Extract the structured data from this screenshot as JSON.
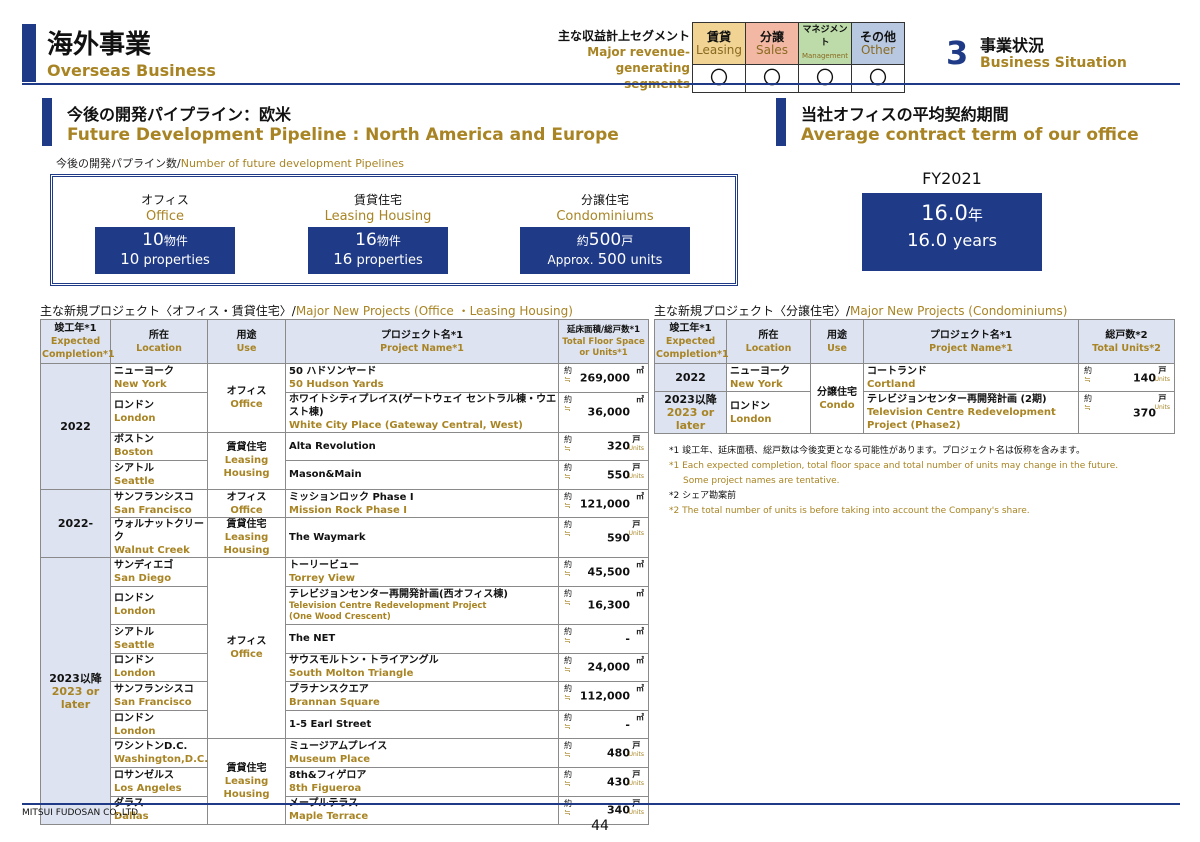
{
  "header": {
    "title": "海外事業",
    "subtitle": "Overseas Business",
    "segment_label_jp": "主な収益計上セグメント",
    "segment_label_en1": "Major revenue-",
    "segment_label_en2": "generating segments",
    "segments": [
      {
        "jp": "賃貸",
        "en": "Leasing",
        "mark": "〇",
        "color": "#f1d493"
      },
      {
        "jp": "分譲",
        "en": "Sales",
        "mark": "〇",
        "color": "#f2b8a3"
      },
      {
        "jp": "マネジメント",
        "en": "Management",
        "mark": "〇",
        "color": "#bcdba8"
      },
      {
        "jp": "その他",
        "en": "Other",
        "mark": "〇",
        "color": "#b8c8e0"
      }
    ],
    "section_number": "3",
    "section_jp": "事業状況",
    "section_en": "Business Situation"
  },
  "pipeline": {
    "heading_jp": "今後の開発パイプライン：欧米",
    "heading_en": "Future Development Pipeline : North America and Europe",
    "caption_jp": "今後の開発パプライン数/",
    "caption_en": "Number of future development Pipelines",
    "items": [
      {
        "jp": "オフィス",
        "en": "Office",
        "value_jp": "10",
        "unit_jp": "物件",
        "value_en": "10",
        "unit_en": "properties",
        "prefix_jp": "",
        "prefix_en": ""
      },
      {
        "jp": "賃貸住宅",
        "en": "Leasing Housing",
        "value_jp": "16",
        "unit_jp": "物件",
        "value_en": "16",
        "unit_en": "properties",
        "prefix_jp": "",
        "prefix_en": ""
      },
      {
        "jp": "分譲住宅",
        "en": "Condominiums",
        "value_jp": "500",
        "unit_jp": "戸",
        "value_en": "500",
        "unit_en": "units",
        "prefix_jp": "約",
        "prefix_en": "Approx."
      }
    ]
  },
  "contract": {
    "heading_jp": "当社オフィスの平均契約期間",
    "heading_en": "Average contract term of our office",
    "fy": "FY2021",
    "value_jp": "16.0",
    "unit_jp": "年",
    "value_en": "16.0",
    "unit_en": "years"
  },
  "office_table": {
    "title_jp": "主な新規プロジェクト〈オフィス・賃貸住宅〉/",
    "title_en": "Major New Projects (Office ・Leasing Housing)",
    "headers": {
      "year_jp": "竣工年*1",
      "year_en": "Expected Completion*1",
      "loc_jp": "所在",
      "loc_en": "Location",
      "use_jp": "用途",
      "use_en": "Use",
      "name_jp": "プロジェクト名*1",
      "name_en": "Project Name*1",
      "area_jp": "延床面積/総戸数*1",
      "area_en": "Total Floor Space or Units*1"
    },
    "approx_jp": "約",
    "approx_eq": "≒",
    "unit_sqm": "㎡",
    "unit_units_jp": "戸",
    "unit_units_en": "Units",
    "groups": [
      {
        "year_jp": "2022",
        "year_en": ""
      },
      {
        "year_jp": "2022-",
        "year_en": ""
      },
      {
        "year_jp": "2023以降",
        "year_en": "2023 or later"
      }
    ],
    "uses": [
      {
        "jp": "オフィス",
        "en": "Office"
      },
      {
        "jp": "賃貸住宅",
        "en": "Leasing Housing"
      },
      {
        "jp": "オフィス",
        "en": "Office"
      },
      {
        "jp": "賃貸住宅",
        "en": "Leasing Housing"
      },
      {
        "jp": "オフィス",
        "en": "Office"
      },
      {
        "jp": "賃貸住宅",
        "en": "Leasing Housing"
      }
    ],
    "rows": [
      {
        "loc_jp": "ニューヨーク",
        "loc_en": "New York",
        "name_jp": "50 ハドソンヤード",
        "name_en": "50 Hudson Yards",
        "value": "269,000",
        "unit": "sqm"
      },
      {
        "loc_jp": "ロンドン",
        "loc_en": "London",
        "name_jp": "ホワイトシティプレイス(ゲートウェイ セントラル棟・ウエスト棟)",
        "name_en": "White City Place (Gateway Central, West)",
        "value": "36,000",
        "unit": "sqm"
      },
      {
        "loc_jp": "ボストン",
        "loc_en": "Boston",
        "name_jp": "Alta Revolution",
        "name_en": "",
        "value": "320",
        "unit": "units"
      },
      {
        "loc_jp": "シアトル",
        "loc_en": "Seattle",
        "name_jp": "Mason&Main",
        "name_en": "",
        "value": "550",
        "unit": "units"
      },
      {
        "loc_jp": "サンフランシスコ",
        "loc_en": "San Francisco",
        "name_jp": "ミッションロック Phase I",
        "name_en": "Mission Rock Phase I",
        "value": "121,000",
        "unit": "sqm"
      },
      {
        "loc_jp": "ウォルナットクリーク",
        "loc_en": "Walnut Creek",
        "name_jp": "The Waymark",
        "name_en": "",
        "value": "590",
        "unit": "units"
      },
      {
        "loc_jp": "サンディエゴ",
        "loc_en": "San Diego",
        "name_jp": "トーリービュー",
        "name_en": "Torrey View",
        "value": "45,500",
        "unit": "sqm"
      },
      {
        "loc_jp": "ロンドン",
        "loc_en": "London",
        "name_jp": "テレビジョンセンター再開発計画(西オフィス棟)",
        "name_en": "Television Centre Redevelopment Project",
        "name_en2": "(One Wood Crescent)",
        "value": "16,300",
        "unit": "sqm"
      },
      {
        "loc_jp": "シアトル",
        "loc_en": "Seattle",
        "name_jp": "The NET",
        "name_en": "",
        "value": "-",
        "unit": "sqm"
      },
      {
        "loc_jp": "ロンドン",
        "loc_en": "London",
        "name_jp": "サウスモルトン・トライアングル",
        "name_en": "South Molton Triangle",
        "value": "24,000",
        "unit": "sqm"
      },
      {
        "loc_jp": "サンフランシスコ",
        "loc_en": "San Francisco",
        "name_jp": "ブラナンスクエア",
        "name_en": "Brannan Square",
        "value": "112,000",
        "unit": "sqm"
      },
      {
        "loc_jp": "ロンドン",
        "loc_en": "London",
        "name_jp": "1-5 Earl Street",
        "name_en": "",
        "value": "-",
        "unit": "sqm"
      },
      {
        "loc_jp": "ワシントンD.C.",
        "loc_en": "Washington,D.C.",
        "name_jp": "ミュージアムプレイス",
        "name_en": "Museum Place",
        "value": "480",
        "unit": "units"
      },
      {
        "loc_jp": "ロサンゼルス",
        "loc_en": "Los Angeles",
        "name_jp": "8th&フィゲロア",
        "name_en": "8th Figueroa",
        "value": "430",
        "unit": "units"
      },
      {
        "loc_jp": "ダラス",
        "loc_en": "Dallas",
        "name_jp": "メープルテラス",
        "name_en": "Maple Terrace",
        "value": "340",
        "unit": "units"
      }
    ]
  },
  "condo_table": {
    "title_jp": "主な新規プロジェクト〈分譲住宅〉/",
    "title_en": "Major New Projects (Condominiums)",
    "headers": {
      "year_jp": "竣工年*1",
      "year_en": "Expected Completion*1",
      "loc_jp": "所在",
      "loc_en": "Location",
      "use_jp": "用途",
      "use_en": "Use",
      "name_jp": "プロジェクト名*1",
      "name_en": "Project Name*1",
      "units_jp": "総戸数*2",
      "units_en": "Total Units*2"
    },
    "use_jp": "分譲住宅",
    "use_en": "Condo",
    "rows": [
      {
        "year_jp": "2022",
        "year_en": "",
        "loc_jp": "ニューヨーク",
        "loc_en": "New York",
        "name_jp": "コートランド",
        "name_en": "Cortland",
        "name_en2": "",
        "value": "140"
      },
      {
        "year_jp": "2023以降",
        "year_en": "2023 or later",
        "loc_jp": "ロンドン",
        "loc_en": "London",
        "name_jp": "テレビジョンセンター再開発計画 (2期)",
        "name_en": "Television Centre Redevelopment",
        "name_en2": "Project (Phase2)",
        "value": "370"
      }
    ]
  },
  "notes": {
    "n1_jp": "*1 竣工年、延床面積、総戸数は今後変更となる可能性があります。プロジェクト名は仮称を含みます。",
    "n1_en": "*1 Each expected completion, total floor space and total number of units may change in the future.",
    "n1_en2": "Some project names are tentative.",
    "n2_jp": "*2 シェア勘案前",
    "n2_en": "*2 The total number of units is before taking into account the Company's share."
  },
  "footer": {
    "company": "MITSUI FUDOSAN CO.,LTD",
    "page": "44"
  }
}
